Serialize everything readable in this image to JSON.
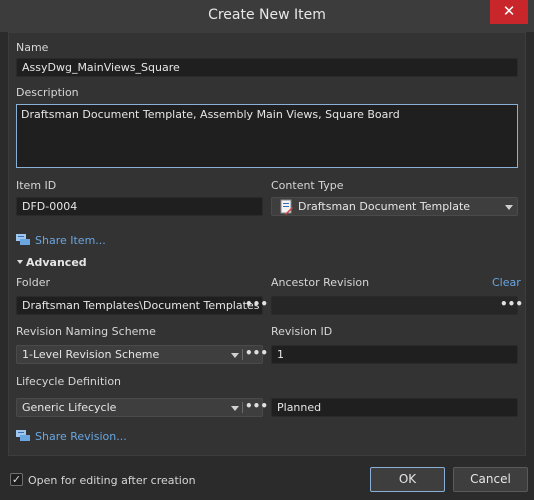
{
  "window": {
    "title": "Create New Item",
    "close_glyph": "✕"
  },
  "form": {
    "name_label": "Name",
    "name_value": "AssyDwg_MainViews_Square",
    "description_label": "Description",
    "description_value": "Draftsman Document Template, Assembly Main Views, Square Board",
    "item_id_label": "Item ID",
    "item_id_value": "DFD-0004",
    "content_type_label": "Content Type",
    "content_type_value": "Draftsman Document Template",
    "share_item_link": "Share Item...",
    "advanced_label": "Advanced",
    "folder_label": "Folder",
    "folder_value": "Draftsman Templates\\Document Templates",
    "ancestor_revision_label": "Ancestor Revision",
    "ancestor_revision_value": "",
    "clear_link": "Clear",
    "revision_scheme_label": "Revision Naming Scheme",
    "revision_scheme_value": "1-Level Revision Scheme",
    "revision_id_label": "Revision ID",
    "revision_id_value": "1",
    "lifecycle_label": "Lifecycle Definition",
    "lifecycle_value": "Generic Lifecycle",
    "lifecycle_state_value": "Planned",
    "share_revision_link": "Share Revision..."
  },
  "footer": {
    "open_for_editing_label": "Open for editing after creation",
    "open_for_editing_checked": true,
    "check_glyph": "✓",
    "ok_label": "OK",
    "cancel_label": "Cancel"
  },
  "icons": {
    "dots": "•••",
    "share_icon": "share-icon",
    "content_type_icon": "draftsman-template-icon"
  },
  "colors": {
    "link": "#6aa6e0",
    "close": "#c8262a",
    "focus_border": "#8ab0d6"
  }
}
